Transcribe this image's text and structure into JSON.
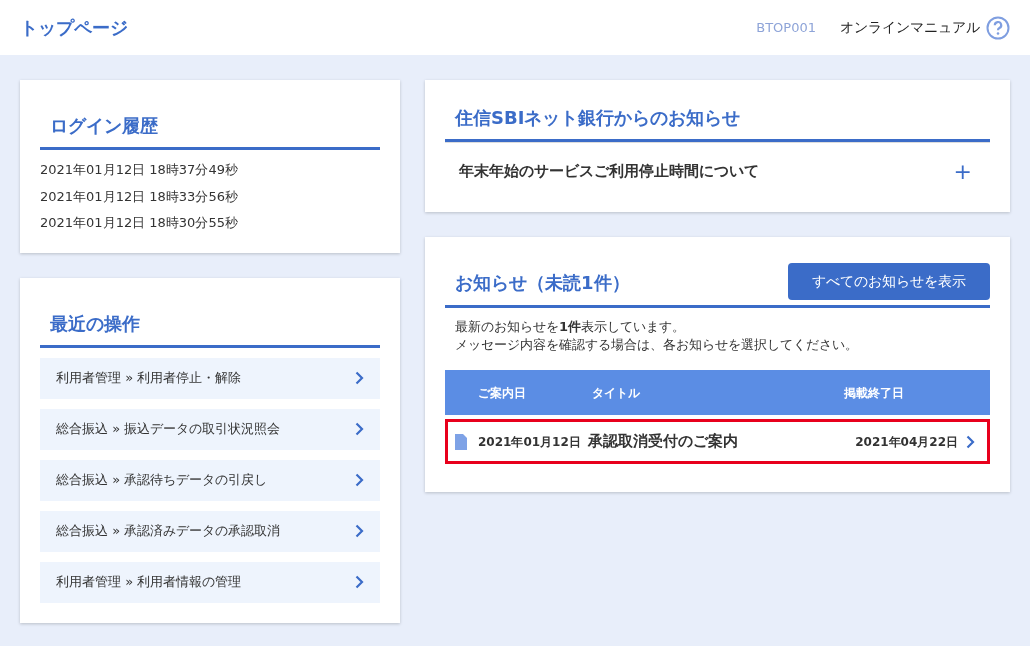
{
  "header": {
    "title": "トップページ",
    "screen_id": "BTOP001",
    "manual_link": "オンラインマニュアル"
  },
  "login_history": {
    "title": "ログイン履歴",
    "entries": [
      "2021年01月12日 18時37分49秒",
      "2021年01月12日 18時33分56秒",
      "2021年01月12日 18時30分55秒"
    ]
  },
  "recent_operations": {
    "title": "最近の操作",
    "items": [
      {
        "label": "利用者管理 » 利用者停止・解除"
      },
      {
        "label": "総合振込 » 振込データの取引状況照会"
      },
      {
        "label": "総合振込 » 承認待ちデータの引戻し"
      },
      {
        "label": "総合振込 » 承認済みデータの承認取消"
      },
      {
        "label": "利用者管理 » 利用者情報の管理"
      }
    ]
  },
  "bank_notices": {
    "title": "住信SBIネット銀行からのお知らせ",
    "items": [
      {
        "title": "年末年始のサービスご利用停止時間について",
        "expanded": false,
        "expand_symbol": "+"
      }
    ]
  },
  "notices": {
    "title": "お知らせ（未読1件）",
    "show_all_button": "すべてのお知らせを表示",
    "intro": [
      "最新のお知らせを**1件**表示しています。",
      "メッセージ内容を確認する場合は、各お知らせを選択してください。"
    ],
    "table": {
      "columns": [
        "ご案内日",
        "タイトル",
        "掲載終了日"
      ],
      "rows": [
        {
          "date": "2021年01月12日",
          "title": "承認取消受付のご案内",
          "end_date": "2021年04月22日",
          "highlighted": true
        }
      ]
    }
  }
}
